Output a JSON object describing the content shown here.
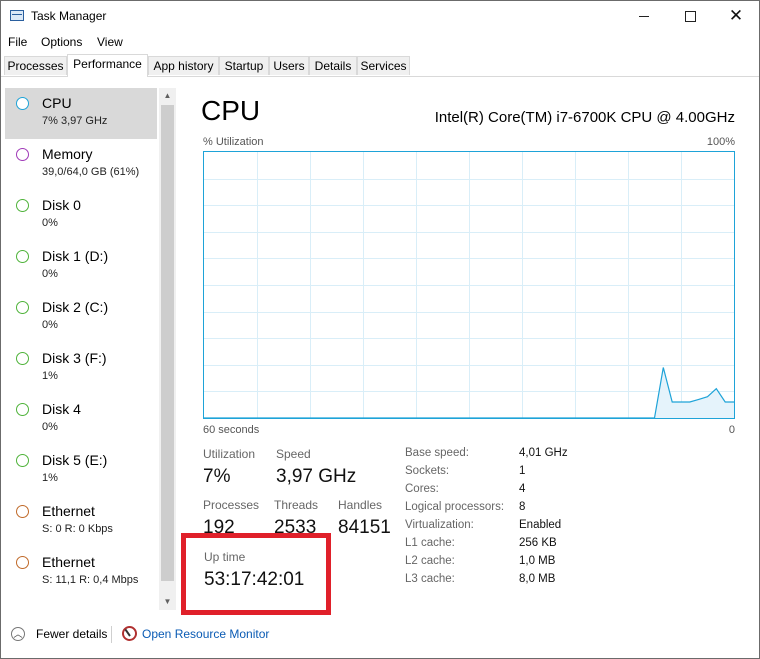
{
  "window": {
    "title": "Task Manager"
  },
  "menu": [
    "File",
    "Options",
    "View"
  ],
  "tabs": [
    "Processes",
    "Performance",
    "App history",
    "Startup",
    "Users",
    "Details",
    "Services"
  ],
  "active_tab": "Performance",
  "sidebar": {
    "items": [
      {
        "name": "CPU",
        "sub": "7% 3,97 GHz",
        "color": "#1ea3d8",
        "active": true
      },
      {
        "name": "Memory",
        "sub": "39,0/64,0 GB (61%)",
        "color": "#a03ab8"
      },
      {
        "name": "Disk 0",
        "sub": "0%",
        "color": "#4fb33a"
      },
      {
        "name": "Disk 1 (D:)",
        "sub": "0%",
        "color": "#4fb33a"
      },
      {
        "name": "Disk 2 (C:)",
        "sub": "0%",
        "color": "#4fb33a"
      },
      {
        "name": "Disk 3 (F:)",
        "sub": "1%",
        "color": "#4fb33a"
      },
      {
        "name": "Disk 4",
        "sub": "0%",
        "color": "#4fb33a"
      },
      {
        "name": "Disk 5 (E:)",
        "sub": "1%",
        "color": "#4fb33a"
      },
      {
        "name": "Ethernet",
        "sub": "S: 0 R: 0 Kbps",
        "color": "#c06a2a"
      },
      {
        "name": "Ethernet",
        "sub": "S: 11,1 R: 0,4 Mbps",
        "color": "#c06a2a"
      }
    ]
  },
  "main": {
    "title": "CPU",
    "model": "Intel(R) Core(TM) i7-6700K CPU @ 4.00GHz",
    "graph": {
      "top_left": "% Utilization",
      "top_right": "100%",
      "bottom_left": "60 seconds",
      "bottom_right": "0"
    },
    "stats": {
      "utilization_label": "Utilization",
      "utilization": "7%",
      "speed_label": "Speed",
      "speed": "3,97 GHz",
      "processes_label": "Processes",
      "processes": "192",
      "threads_label": "Threads",
      "threads": "2533",
      "handles_label": "Handles",
      "handles": "84151",
      "uptime_label": "Up time",
      "uptime": "53:17:42:01"
    },
    "specs": [
      {
        "label": "Base speed:",
        "value": "4,01 GHz"
      },
      {
        "label": "Sockets:",
        "value": "1"
      },
      {
        "label": "Cores:",
        "value": "4"
      },
      {
        "label": "Logical processors:",
        "value": "8"
      },
      {
        "label": "Virtualization:",
        "value": "Enabled"
      },
      {
        "label": "L1 cache:",
        "value": "256 KB"
      },
      {
        "label": "L2 cache:",
        "value": "1,0 MB"
      },
      {
        "label": "L3 cache:",
        "value": "8,0 MB"
      }
    ]
  },
  "footer": {
    "fewer_details": "Fewer details",
    "resource_monitor": "Open Resource Monitor"
  },
  "chart_data": {
    "type": "area",
    "x": [
      60,
      59,
      58,
      57,
      56,
      55,
      54,
      53,
      52,
      51,
      50,
      49,
      48,
      47,
      46,
      45,
      44,
      43,
      42,
      41,
      40,
      39,
      38,
      37,
      36,
      35,
      34,
      33,
      32,
      31,
      30,
      29,
      28,
      27,
      26,
      25,
      24,
      23,
      22,
      21,
      20,
      19,
      18,
      17,
      16,
      15,
      14,
      13,
      12,
      11,
      10,
      9,
      8,
      7,
      6,
      5,
      4,
      3,
      2,
      1,
      0
    ],
    "values": [
      0,
      0,
      0,
      0,
      0,
      0,
      0,
      0,
      0,
      0,
      0,
      0,
      0,
      0,
      0,
      0,
      0,
      0,
      0,
      0,
      0,
      0,
      0,
      0,
      0,
      0,
      0,
      0,
      0,
      0,
      0,
      0,
      0,
      0,
      0,
      0,
      0,
      0,
      0,
      0,
      0,
      0,
      0,
      0,
      0,
      0,
      0,
      0,
      0,
      0,
      0,
      0,
      19,
      6,
      6,
      6,
      7,
      8,
      11,
      6,
      6
    ],
    "ylim": [
      0,
      100
    ],
    "xlabel": "60 seconds",
    "ylabel": "% Utilization",
    "grid": true,
    "line_color": "#1ea3d8",
    "fill_color": "#e5f3fb"
  }
}
